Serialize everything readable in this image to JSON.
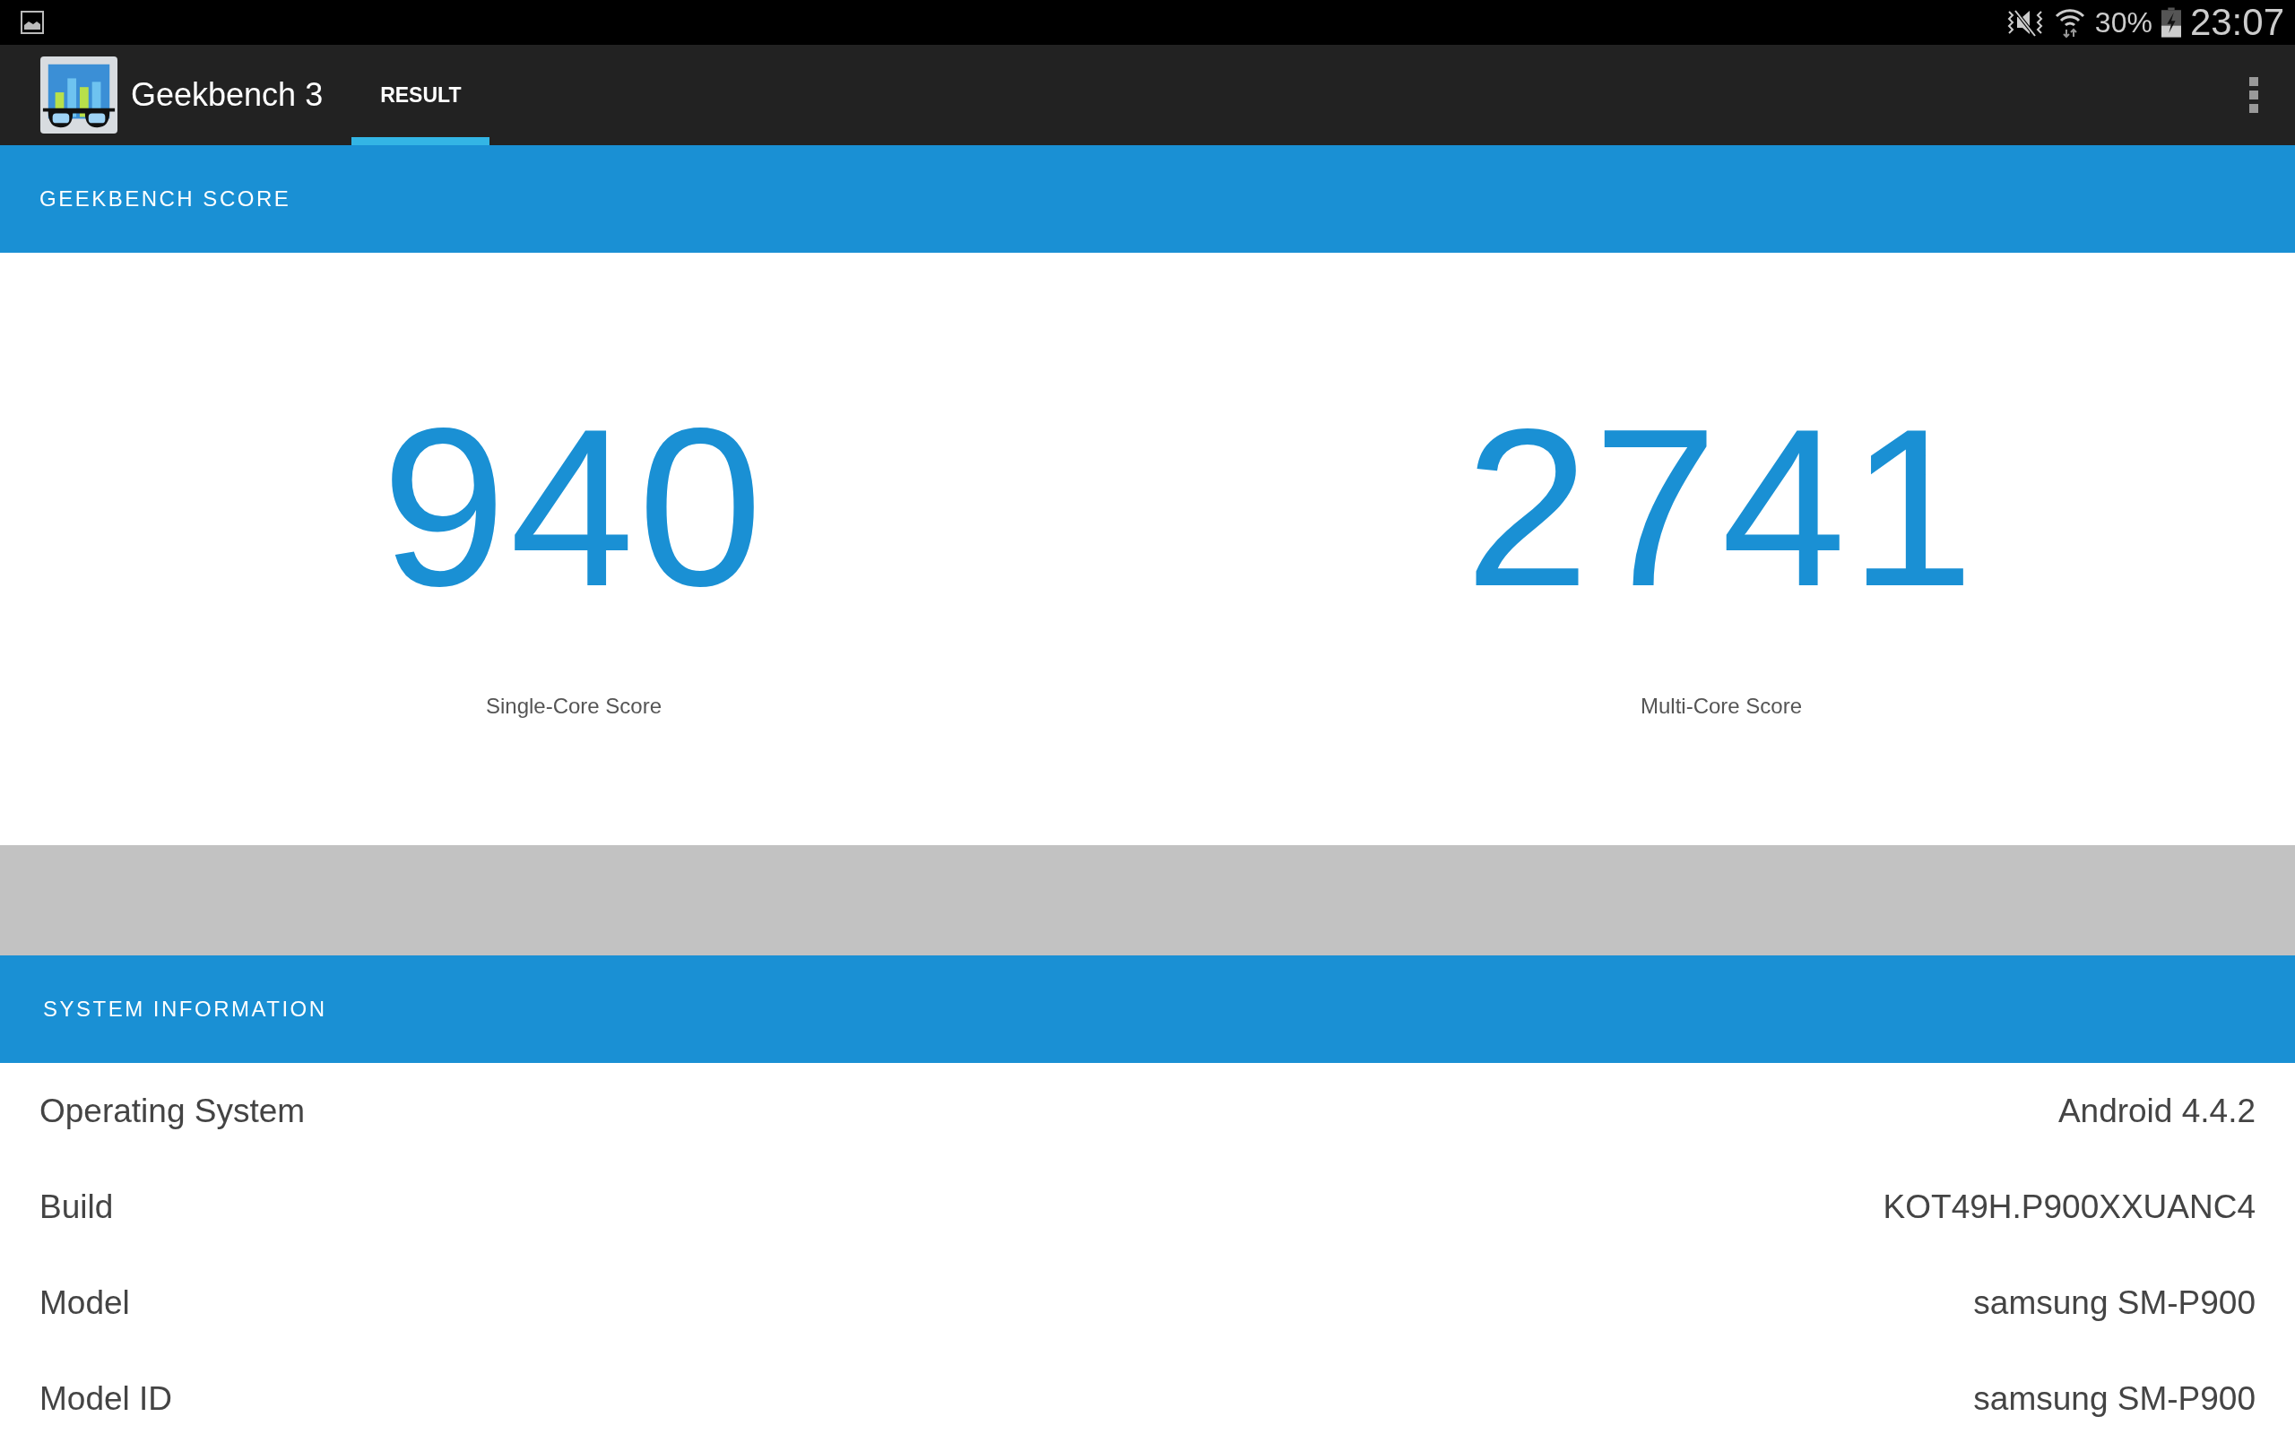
{
  "status_bar": {
    "battery": "30%",
    "time": "23:07"
  },
  "app_bar": {
    "title": "Geekbench 3",
    "tabs": [
      {
        "label": "RESULT",
        "selected": true
      }
    ]
  },
  "score_section": {
    "header": "GEEKBENCH SCORE",
    "scores": [
      {
        "value": "940",
        "label": "Single-Core Score"
      },
      {
        "value": "2741",
        "label": "Multi-Core Score"
      }
    ]
  },
  "system_information": {
    "header": "SYSTEM INFORMATION",
    "rows": [
      {
        "name": "Operating System",
        "value": "Android 4.4.2"
      },
      {
        "name": "Build",
        "value": "KOT49H.P900XXUANC4"
      },
      {
        "name": "Model",
        "value": "samsung SM-P900"
      },
      {
        "name": "Model ID",
        "value": "samsung SM-P900"
      }
    ]
  }
}
